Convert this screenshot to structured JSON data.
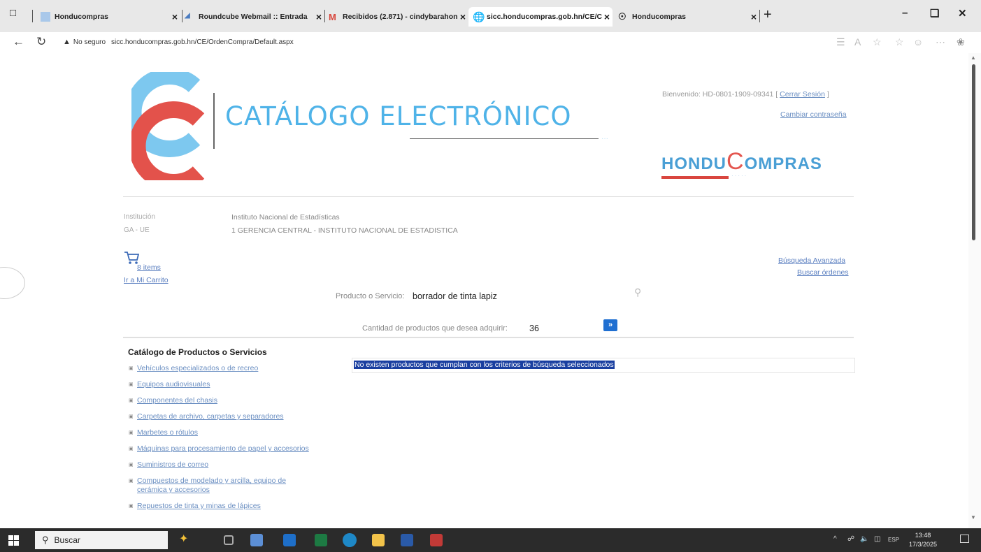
{
  "browser": {
    "tabs": [
      {
        "label": "Honducompras"
      },
      {
        "label": "Roundcube Webmail :: Entrada"
      },
      {
        "label": "Recibidos (2.871) - cindybarahon"
      },
      {
        "label": "sicc.honducompras.gob.hn/CE/C",
        "active": true
      },
      {
        "label": "Honducompras"
      }
    ],
    "new_tab": "+",
    "security": "No seguro",
    "url": "sicc.honducompras.gob.hn/CE/OrdenCompra/Default.aspx"
  },
  "header": {
    "title": "CATÁLOGO ELECTRÓNICO",
    "welcome_text": "Bienvenido: HD-0801-1909-09341",
    "logout": "Cerrar Sesión",
    "change_password": "Cambiar contraseña",
    "brand_part1": "HONDU",
    "brand_c": "C",
    "brand_part2": "OMPRAS"
  },
  "institution": {
    "institucion_label": "Institución",
    "institucion_value": "Instituto Nacional de Estadísticas",
    "ga_ue_label": "GA - UE",
    "ga_ue_value": "1 GERENCIA CENTRAL - INSTITUTO NACIONAL DE ESTADISTICA"
  },
  "cart": {
    "items": "8 items",
    "link": "Ir a Mi Carrito"
  },
  "links": {
    "advanced_search": "Búsqueda Avanzada",
    "find_orders": "Buscar órdenes"
  },
  "search": {
    "product_label": "Producto o Servicio:",
    "product_value": "borrador de tinta lapiz",
    "quantity_label": "Cantidad de productos que desea adquirir:",
    "quantity_value": "36",
    "go_label": "»"
  },
  "catalog": {
    "heading": "Catálogo de Productos o Servicios",
    "items": [
      "Vehículos especializados o de recreo",
      "Equipos audiovisuales",
      "Componentes del chasis",
      "Carpetas de archivo, carpetas y separadores",
      "Marbetes o rótulos",
      "Máquinas para procesamiento de papel y accesorios",
      "Suministros de correo",
      "Compuestos de modelado y arcilla, equipo de cerámica y accesorios",
      "Repuestos de tinta y minas de lápices"
    ]
  },
  "results": {
    "message": "No existen productos que cumplan con los criterios de búsqueda seleccionados"
  },
  "taskbar": {
    "search": "Buscar",
    "tray_lang": "ESP",
    "time": "13:48",
    "date": "17/3/2025"
  }
}
